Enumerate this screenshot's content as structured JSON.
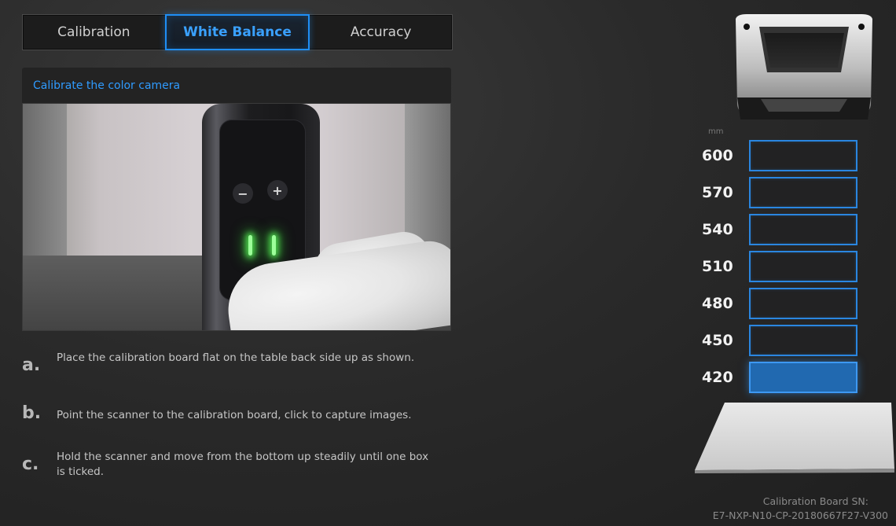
{
  "tabs": [
    {
      "label": "Calibration",
      "active": false
    },
    {
      "label": "White Balance",
      "active": true
    },
    {
      "label": "Accuracy",
      "active": false
    }
  ],
  "panel": {
    "header": "Calibrate the color camera"
  },
  "steps": [
    {
      "letter": "a.",
      "text": "Place the calibration board flat on the table back side up as shown."
    },
    {
      "letter": "b.",
      "text": "Point the scanner to the calibration board, click  to capture images."
    },
    {
      "letter": "c.",
      "text": "Hold the scanner and move from the bottom up steadily until one box is ticked."
    }
  ],
  "distance": {
    "unit": "mm",
    "levels": [
      {
        "value": "600",
        "active": false
      },
      {
        "value": "570",
        "active": false
      },
      {
        "value": "540",
        "active": false
      },
      {
        "value": "510",
        "active": false
      },
      {
        "value": "480",
        "active": false
      },
      {
        "value": "450",
        "active": false
      },
      {
        "value": "420",
        "active": true
      }
    ]
  },
  "board_sn": {
    "label": "Calibration Board SN:",
    "value": "E7-NXP-N10-CP-20180667F27-V300"
  },
  "colors": {
    "accent": "#1f8ef5",
    "active_box": "#2169b0",
    "header_text": "#2f9bff"
  }
}
